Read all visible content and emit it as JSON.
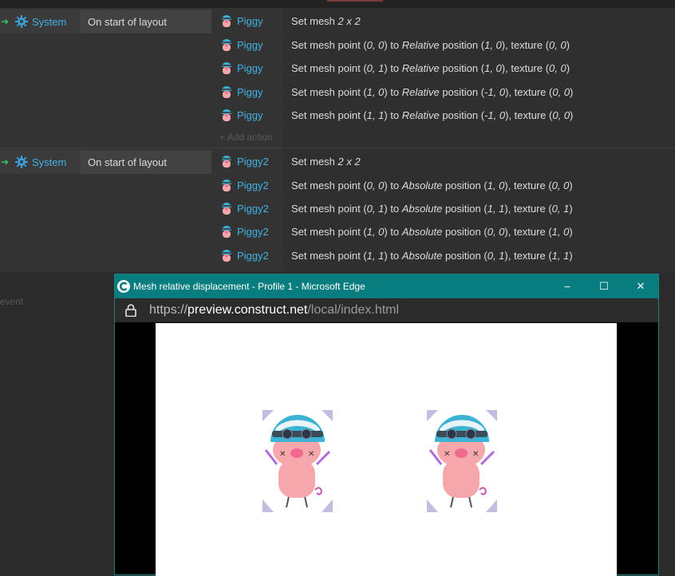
{
  "events": [
    {
      "condition": {
        "object": "System",
        "text": "On start of layout"
      },
      "actions": [
        {
          "object": "Piggy",
          "parts": [
            [
              "Set mesh ",
              false
            ],
            [
              "2 x 2",
              true
            ]
          ]
        },
        {
          "object": "Piggy",
          "parts": [
            [
              "Set mesh point (",
              false
            ],
            [
              "0, 0",
              true
            ],
            [
              ") to ",
              false
            ],
            [
              "Relative",
              true
            ],
            [
              " position (",
              false
            ],
            [
              "1, 0",
              true
            ],
            [
              "), texture (",
              false
            ],
            [
              "0, 0",
              true
            ],
            [
              ")",
              false
            ]
          ]
        },
        {
          "object": "Piggy",
          "parts": [
            [
              "Set mesh point (",
              false
            ],
            [
              "0, 1",
              true
            ],
            [
              ") to ",
              false
            ],
            [
              "Relative",
              true
            ],
            [
              " position (",
              false
            ],
            [
              "1, 0",
              true
            ],
            [
              "), texture (",
              false
            ],
            [
              "0, 0",
              true
            ],
            [
              ")",
              false
            ]
          ]
        },
        {
          "object": "Piggy",
          "parts": [
            [
              "Set mesh point (",
              false
            ],
            [
              "1, 0",
              true
            ],
            [
              ") to ",
              false
            ],
            [
              "Relative",
              true
            ],
            [
              " position (",
              false
            ],
            [
              "-1, 0",
              true
            ],
            [
              "), texture (",
              false
            ],
            [
              "0, 0",
              true
            ],
            [
              ")",
              false
            ]
          ]
        },
        {
          "object": "Piggy",
          "parts": [
            [
              "Set mesh point (",
              false
            ],
            [
              "1, 1",
              true
            ],
            [
              ") to ",
              false
            ],
            [
              "Relative",
              true
            ],
            [
              " position (",
              false
            ],
            [
              "-1, 0",
              true
            ],
            [
              "), texture (",
              false
            ],
            [
              "0, 0",
              true
            ],
            [
              ")",
              false
            ]
          ]
        }
      ],
      "add_action": "Add action"
    },
    {
      "condition": {
        "object": "System",
        "text": "On start of layout"
      },
      "actions": [
        {
          "object": "Piggy2",
          "parts": [
            [
              "Set mesh ",
              false
            ],
            [
              "2 x 2",
              true
            ]
          ]
        },
        {
          "object": "Piggy2",
          "parts": [
            [
              "Set mesh point (",
              false
            ],
            [
              "0, 0",
              true
            ],
            [
              ") to ",
              false
            ],
            [
              "Absolute",
              true
            ],
            [
              " position (",
              false
            ],
            [
              "1, 0",
              true
            ],
            [
              "), texture (",
              false
            ],
            [
              "0, 0",
              true
            ],
            [
              ")",
              false
            ]
          ]
        },
        {
          "object": "Piggy2",
          "parts": [
            [
              "Set mesh point (",
              false
            ],
            [
              "0, 1",
              true
            ],
            [
              ") to ",
              false
            ],
            [
              "Absolute",
              true
            ],
            [
              " position (",
              false
            ],
            [
              "1, 1",
              true
            ],
            [
              "), texture (",
              false
            ],
            [
              "0, 1",
              true
            ],
            [
              ")",
              false
            ]
          ]
        },
        {
          "object": "Piggy2",
          "parts": [
            [
              "Set mesh point (",
              false
            ],
            [
              "1, 0",
              true
            ],
            [
              ") to ",
              false
            ],
            [
              "Absolute",
              true
            ],
            [
              " position (",
              false
            ],
            [
              "0, 0",
              true
            ],
            [
              "), texture (",
              false
            ],
            [
              "1, 0",
              true
            ],
            [
              ")",
              false
            ]
          ]
        },
        {
          "object": "Piggy2",
          "parts": [
            [
              "Set mesh point (",
              false
            ],
            [
              "1, 1",
              true
            ],
            [
              ") to ",
              false
            ],
            [
              "Absolute",
              true
            ],
            [
              " position (",
              false
            ],
            [
              "0, 1",
              true
            ],
            [
              "), texture (",
              false
            ],
            [
              "1, 1",
              true
            ],
            [
              ")",
              false
            ]
          ]
        }
      ]
    }
  ],
  "event_hint": "event",
  "browser": {
    "title": "Mesh relative displacement - Profile 1 - Microsoft Edge",
    "url_scheme": "https://",
    "url_host": "preview.construct.net",
    "url_path": "/local/index.html",
    "minimize": "–",
    "maximize": "☐",
    "close": "✕"
  },
  "icons": {
    "condition": "gear-icon",
    "action": "piggy-icon",
    "lock": "lock-icon",
    "app": "construct-logo-icon"
  },
  "colors": {
    "object_link": "#40b2e6",
    "titlebar": "#087d80",
    "trigger_arrow": "#39c36d"
  }
}
